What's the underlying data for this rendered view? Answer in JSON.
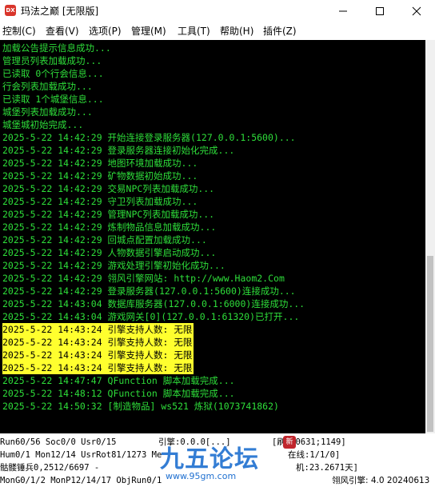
{
  "window": {
    "icon_text": "DX",
    "title": "玛法之巅 [无限版]"
  },
  "menu": [
    {
      "label": "控制(C)"
    },
    {
      "label": "查看(V)"
    },
    {
      "label": "选项(P)"
    },
    {
      "label": "管理(M)"
    },
    {
      "label": "工具(T)"
    },
    {
      "label": "帮助(H)"
    },
    {
      "label": "插件(Z)"
    }
  ],
  "console": {
    "text_color": "#2ede3a",
    "highlight_color": "#ffff2e",
    "lines": [
      {
        "text": "加载公告提示信息成功...",
        "highlight": false
      },
      {
        "text": "管理员列表加载成功...",
        "highlight": false
      },
      {
        "text": "已读取 0个行会信息...",
        "highlight": false
      },
      {
        "text": "行会列表加载成功...",
        "highlight": false
      },
      {
        "text": "已读取 1个城堡信息...",
        "highlight": false
      },
      {
        "text": "城堡列表加载成功...",
        "highlight": false
      },
      {
        "text": "城堡城初始完成...",
        "highlight": false
      },
      {
        "text": "2025-5-22 14:42:29 开始连接登录服务器(127.0.0.1:5600)...",
        "highlight": false
      },
      {
        "text": "2025-5-22 14:42:29 登录服务器连接初始化完成...",
        "highlight": false
      },
      {
        "text": "2025-5-22 14:42:29 地图环境加载成功...",
        "highlight": false
      },
      {
        "text": "2025-5-22 14:42:29 矿物数据初始成功...",
        "highlight": false
      },
      {
        "text": "2025-5-22 14:42:29 交易NPC列表加载成功...",
        "highlight": false
      },
      {
        "text": "2025-5-22 14:42:29 守卫列表加载成功...",
        "highlight": false
      },
      {
        "text": "2025-5-22 14:42:29 管理NPC列表加载成功...",
        "highlight": false
      },
      {
        "text": "2025-5-22 14:42:29 炼制物品信息加载成功...",
        "highlight": false
      },
      {
        "text": "2025-5-22 14:42:29 回城点配置加载成功...",
        "highlight": false
      },
      {
        "text": "2025-5-22 14:42:29 人物数据引擎启动成功...",
        "highlight": false
      },
      {
        "text": "2025-5-22 14:42:29 游戏处理引擎初始化成功...",
        "highlight": false
      },
      {
        "text": "2025-5-22 14:42:29 翎风引擎网站: http://www.Haom2.Com",
        "highlight": false
      },
      {
        "text": "2025-5-22 14:42:29 登录服务器(127.0.0.1:5600)连接成功...",
        "highlight": false
      },
      {
        "text": "2025-5-22 14:43:04 数据库服务器(127.0.0.1:6000)连接成功...",
        "highlight": false
      },
      {
        "text": "2025-5-22 14:43:04 游戏网关[0](127.0.0.1:61320)已打开...",
        "highlight": false
      },
      {
        "text": "2025-5-22 14:43:24 引擎支持人数: 无限",
        "highlight": true
      },
      {
        "text": "2025-5-22 14:43:24 引擎支持人数: 无限",
        "highlight": true
      },
      {
        "text": "2025-5-22 14:43:24 引擎支持人数: 无限",
        "highlight": true
      },
      {
        "text": "2025-5-22 14:43:24 引擎支持人数: 无限",
        "highlight": true
      },
      {
        "text": "2025-5-22 14:47:47 QFunction 脚本加载完成...",
        "highlight": false
      },
      {
        "text": "2025-5-22 14:48:12 QFunction 脚本加载完成...",
        "highlight": false
      },
      {
        "text": "2025-5-22 14:50:32 [制造物品] ws521 炼狱(1073741862)",
        "highlight": false
      }
    ]
  },
  "status": {
    "row1_left": "Run60/56 Soc0/0 Usr0/15",
    "row1_mid": "引擎:0.0.0[...]",
    "row1_right": "[刷 30631;1149]",
    "row2_left": "Hum0/1 Mon12/14 UsrRot81/1273 Me",
    "row2_right": "在线:1/1/0]",
    "row3_left": "骷髅锤兵0,2512/6697 -",
    "row3_right": "机:23.2671天]",
    "row4_left": "MonG0/1/2 MonP12/14/17 ObjRun0/1",
    "version": "翎风引擎: 4.0 20240613"
  },
  "watermark": {
    "logo": "九五论坛",
    "url": "www.95gm.com",
    "badge": "新"
  }
}
